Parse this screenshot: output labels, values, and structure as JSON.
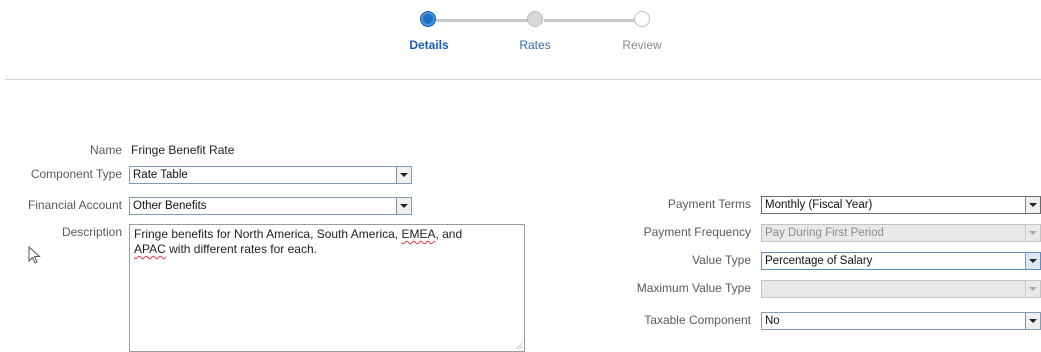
{
  "train": {
    "steps": [
      {
        "label": "Details",
        "state": "current"
      },
      {
        "label": "Rates",
        "state": "visited"
      },
      {
        "label": "Review",
        "state": "unvisited"
      }
    ]
  },
  "form": {
    "name": {
      "label": "Name",
      "value": "Fringe Benefit Rate"
    },
    "component_type": {
      "label": "Component Type",
      "value": "Rate Table"
    },
    "financial_account": {
      "label": "Financial Account",
      "value": "Other Benefits"
    },
    "description": {
      "label": "Description",
      "line1": "Fringe benefits for North America, South America, ",
      "emea": "EMEA",
      "line1_end": ", and",
      "apac": "APAC",
      "line2": " with different rates for each."
    },
    "payment_terms": {
      "label": "Payment Terms",
      "value": "Monthly (Fiscal Year)"
    },
    "payment_frequency": {
      "label": "Payment Frequency",
      "value": "Pay During First Period",
      "disabled": true
    },
    "value_type": {
      "label": "Value Type",
      "value": "Percentage of Salary"
    },
    "maximum_value_type": {
      "label": "Maximum Value Type",
      "value": "",
      "disabled": true
    },
    "taxable_component": {
      "label": "Taxable Component",
      "value": "No"
    }
  },
  "colors": {
    "accent": "#1b6fc8",
    "label": "#5a5a5a",
    "disabled_bg": "#e9e9e9"
  },
  "icons": [
    "mouse-pointer-icon",
    "chevron-down-icon"
  ]
}
